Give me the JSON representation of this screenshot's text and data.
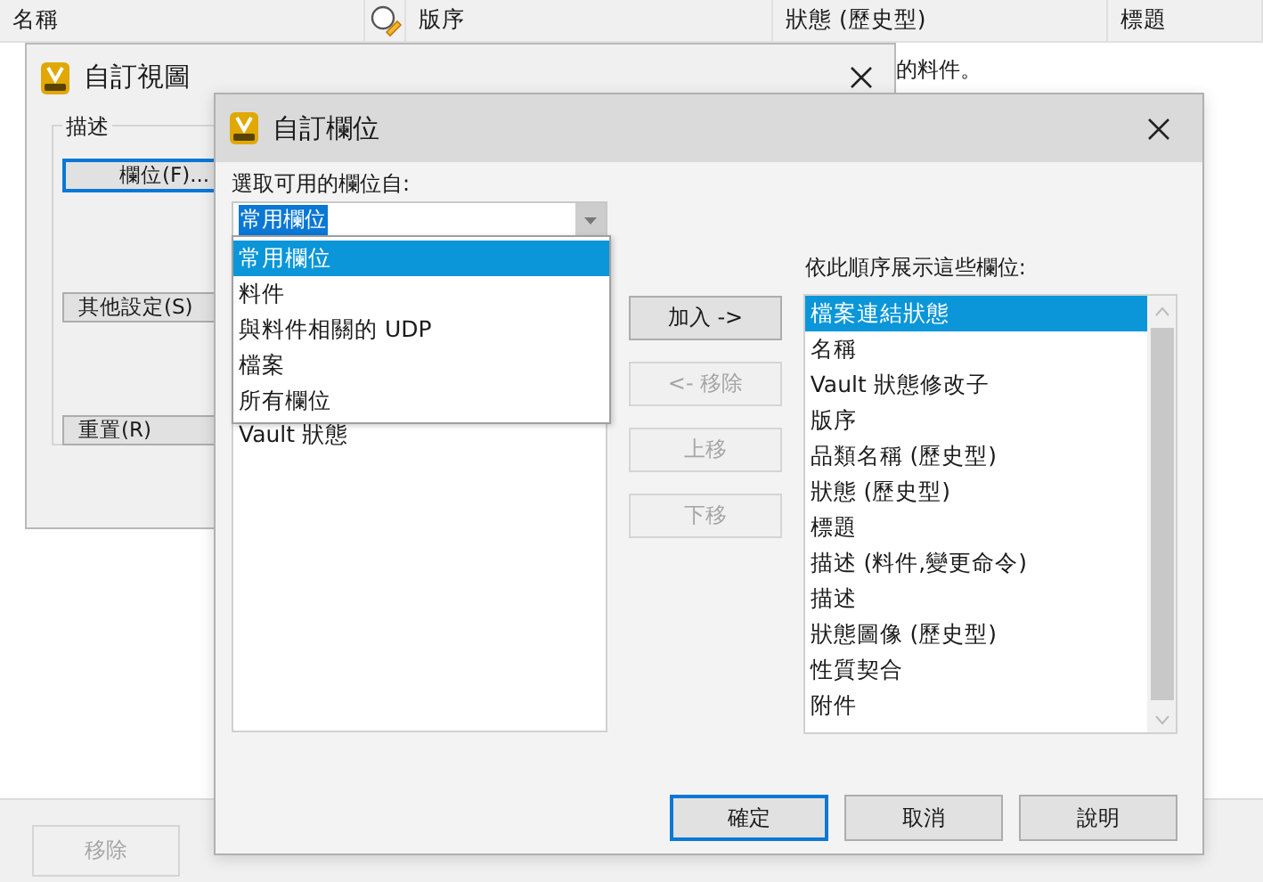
{
  "table": {
    "columns": [
      {
        "kind": "text",
        "label": "名稱"
      },
      {
        "kind": "icon"
      },
      {
        "kind": "text",
        "label": "版序"
      },
      {
        "kind": "text",
        "label": "狀態 (歷史型)"
      },
      {
        "kind": "text",
        "label": "標題"
      }
    ],
    "rows": [
      {
        "text": "的料件。"
      }
    ]
  },
  "bottom_bar": {
    "buttons": [
      {
        "label": "移除",
        "disabled": true
      }
    ]
  },
  "view_dialog": {
    "title": "自訂視圖",
    "group_label": "描述",
    "buttons": [
      {
        "label": "欄位(F)...",
        "focused": true
      },
      {
        "label": "其他設定(S)",
        "focused": false
      },
      {
        "label": "重置(R)",
        "focused": false
      }
    ]
  },
  "columns_dialog": {
    "title": "自訂欄位",
    "source_label": "選取可用的欄位自:",
    "source_combo": {
      "value": "常用欄位",
      "expanded": true,
      "options": [
        {
          "label": "常用欄位",
          "selected": true
        },
        {
          "label": "料件",
          "selected": false
        },
        {
          "label": "與料件相關的 UDP",
          "selected": false
        },
        {
          "label": "檔案",
          "selected": false
        },
        {
          "label": "所有欄位",
          "selected": false
        }
      ]
    },
    "available_fields": [
      {
        "label": "Vault 狀態"
      }
    ],
    "move_buttons": [
      {
        "label": "加入 ->",
        "disabled": false
      },
      {
        "label": "<- 移除",
        "disabled": true
      },
      {
        "label": "上移",
        "disabled": true
      },
      {
        "label": "下移",
        "disabled": true
      }
    ],
    "order_label": "依此順序展示這些欄位:",
    "ordered_fields": [
      {
        "label": "檔案連結狀態",
        "selected": true
      },
      {
        "label": "名稱",
        "selected": false
      },
      {
        "label": "Vault 狀態修改子",
        "selected": false
      },
      {
        "label": "版序",
        "selected": false
      },
      {
        "label": "品類名稱 (歷史型)",
        "selected": false
      },
      {
        "label": "狀態 (歷史型)",
        "selected": false
      },
      {
        "label": "標題",
        "selected": false
      },
      {
        "label": "描述 (料件,變更命令)",
        "selected": false
      },
      {
        "label": "描述",
        "selected": false
      },
      {
        "label": "狀態圖像 (歷史型)",
        "selected": false
      },
      {
        "label": "性質契合",
        "selected": false
      },
      {
        "label": "附件",
        "selected": false
      }
    ],
    "buttons": [
      {
        "label": "確定",
        "default": true
      },
      {
        "label": "取消",
        "default": false
      },
      {
        "label": "說明",
        "default": false
      }
    ]
  }
}
